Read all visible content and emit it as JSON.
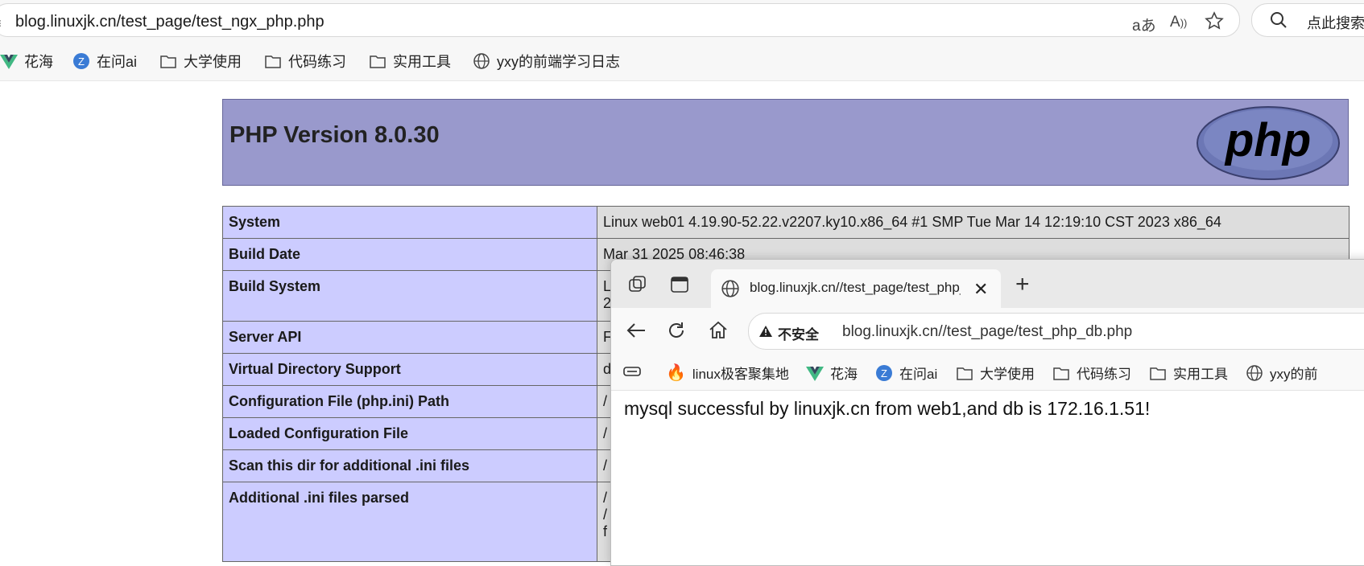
{
  "browser": {
    "url": "blog.linuxjk.cn/test_page/test_ngx_php.php",
    "search_placeholder": "点此搜索",
    "bookmarks": [
      {
        "label": "花海",
        "icon": "vue-icon"
      },
      {
        "label": "在问ai",
        "icon": "zaiwen-icon"
      },
      {
        "label": "大学使用",
        "icon": "folder-icon"
      },
      {
        "label": "代码练习",
        "icon": "folder-icon"
      },
      {
        "label": "实用工具",
        "icon": "folder-icon"
      },
      {
        "label": "yxy的前端学习日志",
        "icon": "globe-icon"
      }
    ]
  },
  "php": {
    "title": "PHP Version 8.0.30",
    "logo_text": "php",
    "rows": [
      {
        "key": "System",
        "value": "Linux web01 4.19.90-52.22.v2207.ky10.x86_64 #1 SMP Tue Mar 14 12:19:10 CST 2023 x86_64"
      },
      {
        "key": "Build Date",
        "value": "Mar 31 2025 08:46:38"
      },
      {
        "key": "Build System",
        "value": "L",
        "value2": "2"
      },
      {
        "key": "Server API",
        "value": "F"
      },
      {
        "key": "Virtual Directory Support",
        "value": "d"
      },
      {
        "key": "Configuration File (php.ini) Path",
        "value": "/"
      },
      {
        "key": "Loaded Configuration File",
        "value": "/"
      },
      {
        "key": "Scan this dir for additional .ini files",
        "value": "/"
      },
      {
        "key": "Additional .ini files parsed",
        "value": "/",
        "value2": "/",
        "value3": "f"
      }
    ]
  },
  "popup": {
    "tab_title": "blog.linuxjk.cn//test_page/test_php_db.php",
    "insecure_label": "不安全",
    "url": "blog.linuxjk.cn//test_page/test_php_db.php",
    "bookmarks": [
      {
        "label": "linux极客聚集地",
        "icon": "fire-icon"
      },
      {
        "label": "花海",
        "icon": "vue-icon"
      },
      {
        "label": "在问ai",
        "icon": "zaiwen-icon"
      },
      {
        "label": "大学使用",
        "icon": "folder-icon"
      },
      {
        "label": "代码练习",
        "icon": "folder-icon"
      },
      {
        "label": "实用工具",
        "icon": "folder-icon"
      },
      {
        "label": "yxy的前",
        "icon": "globe-icon"
      }
    ],
    "message": "mysql successful by linuxjk.cn from web1,and db is 172.16.1.51!"
  }
}
